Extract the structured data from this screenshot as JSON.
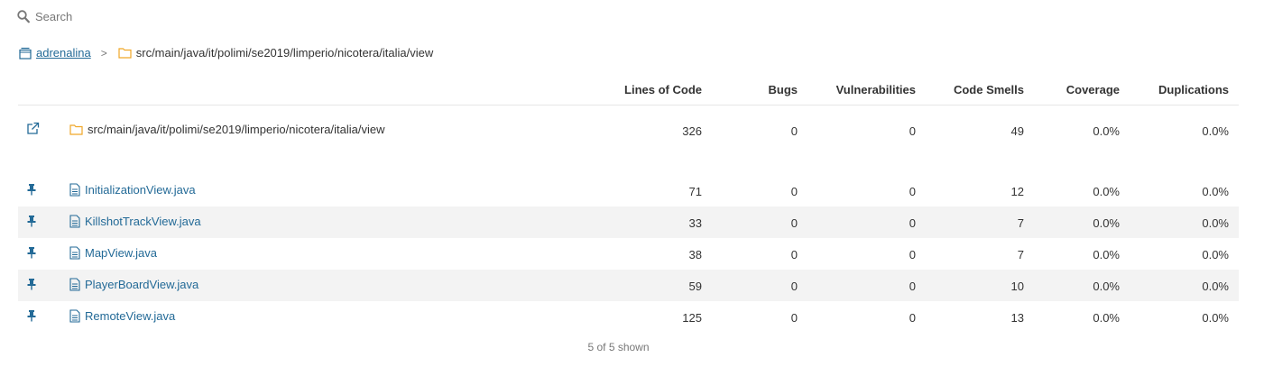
{
  "search": {
    "placeholder": "Search"
  },
  "breadcrumb": {
    "project": "adrenalina",
    "separator": ">",
    "directory": "src/main/java/it/polimi/se2019/limperio/nicotera/italia/view"
  },
  "table": {
    "columns": [
      "Lines of Code",
      "Bugs",
      "Vulnerabilities",
      "Code Smells",
      "Coverage",
      "Duplications"
    ],
    "base_row": {
      "name": "src/main/java/it/polimi/se2019/limperio/nicotera/italia/view",
      "lines": "326",
      "bugs": "0",
      "vulnerabilities": "0",
      "code_smells": "49",
      "coverage": "0.0%",
      "duplications": "0.0%"
    },
    "rows": [
      {
        "name": "InitializationView.java",
        "lines": "71",
        "bugs": "0",
        "vulnerabilities": "0",
        "code_smells": "12",
        "coverage": "0.0%",
        "duplications": "0.0%"
      },
      {
        "name": "KillshotTrackView.java",
        "lines": "33",
        "bugs": "0",
        "vulnerabilities": "0",
        "code_smells": "7",
        "coverage": "0.0%",
        "duplications": "0.0%"
      },
      {
        "name": "MapView.java",
        "lines": "38",
        "bugs": "0",
        "vulnerabilities": "0",
        "code_smells": "7",
        "coverage": "0.0%",
        "duplications": "0.0%"
      },
      {
        "name": "PlayerBoardView.java",
        "lines": "59",
        "bugs": "0",
        "vulnerabilities": "0",
        "code_smells": "10",
        "coverage": "0.0%",
        "duplications": "0.0%"
      },
      {
        "name": "RemoteView.java",
        "lines": "125",
        "bugs": "0",
        "vulnerabilities": "0",
        "code_smells": "13",
        "coverage": "0.0%",
        "duplications": "0.0%"
      }
    ]
  },
  "footer": {
    "shown_text": "5 of 5 shown"
  },
  "colors": {
    "link": "#236a97",
    "folder": "#f0a728",
    "row_alt": "#f3f3f3"
  },
  "icons": {
    "search": "search-icon",
    "project": "project-icon",
    "folder": "folder-icon",
    "file": "file-icon",
    "pin": "pin-icon",
    "open": "external-link-icon"
  }
}
